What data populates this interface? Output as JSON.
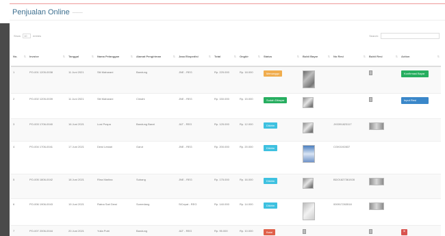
{
  "header": {
    "title": "Penjualan Online",
    "subtitle": "———"
  },
  "controls": {
    "show_label": "Show",
    "entries_value": "10",
    "entries_label": "entries",
    "search_label": "Search:"
  },
  "table": {
    "columns": [
      "No.",
      "Invoice",
      "Tanggal",
      "Nama Pelanggan",
      "Alamat Pengiriman",
      "Jasa Ekspedisi",
      "Total",
      "Ongkir",
      "Status",
      "Bukti Bayar",
      "No Resi",
      "Bukti Resi",
      "Action"
    ],
    "rows": [
      {
        "no": "1",
        "invoice": "PO-001 1205-0038",
        "date": "11 Juni 2021",
        "name": "Siti Maharani",
        "address": "Bandung",
        "courier": "JNE - REG",
        "total": "Rp. 225.000",
        "ongkir": "Rp. 18.000",
        "status": "Menunggu",
        "status_color": "warning",
        "bukti": "tall",
        "resi": "",
        "bukti_resi": "icon",
        "action": "Konfirmasi Bayar",
        "action_color": "green"
      },
      {
        "no": "2",
        "invoice": "PO-002 1205-0039",
        "date": "11 Juni 2021",
        "name": "Siti Maharani",
        "address": "Cimahi",
        "courier": "JNE - REG",
        "total": "Rp. 150.000",
        "ongkir": "Rp. 15.000",
        "status": "Sudah Dibayar",
        "status_color": "success",
        "bukti": "sq",
        "resi": "",
        "bukti_resi": "icon",
        "action": "Input Resi",
        "action_color": "blue"
      },
      {
        "no": "3",
        "invoice": "PO-003 1706-0040",
        "date": "16 Juni 2021",
        "name": "Lusi Puspa",
        "address": "Bandung Barat",
        "courier": "J&T - REG",
        "total": "Rp. 125.000",
        "ongkir": "Rp. 12.000",
        "status": "Dikirim",
        "status_color": "info",
        "bukti": "sq",
        "resi": "JX0391823117",
        "bukti_resi": "wide",
        "action": "",
        "action_color": ""
      },
      {
        "no": "4",
        "invoice": "PO-004 1706-0041",
        "date": "17 Juni 2021",
        "name": "Dewi Lestari",
        "address": "Garut",
        "courier": "JNE - REG",
        "total": "Rp. 200.000",
        "ongkir": "Rp. 20.000",
        "status": "Dikirim",
        "status_color": "info",
        "bukti": "blue",
        "resi": "CGK0192837",
        "bukti_resi": "",
        "action": "",
        "action_color": ""
      },
      {
        "no": "5",
        "invoice": "PO-005 1806-0042",
        "date": "18 Juni 2021",
        "name": "Rina Marlina",
        "address": "Subang",
        "courier": "JNE - REG",
        "total": "Rp. 175.000",
        "ongkir": "Rp. 16.000",
        "status": "Dikirim",
        "status_color": "info",
        "bukti": "sq",
        "resi": "BDO1827361928",
        "bukti_resi": "wide",
        "action": "",
        "action_color": ""
      },
      {
        "no": "6",
        "invoice": "PO-006 1906-0043",
        "date": "19 Juni 2021",
        "name": "Ratna Sari Dewi",
        "address": "Sumedang",
        "courier": "SiCepat - REG",
        "total": "Rp. 140.000",
        "ongkir": "Rp. 14.000",
        "status": "Dikirim",
        "status_color": "info",
        "bukti": "paper",
        "resi": "000917263518",
        "bukti_resi": "wide",
        "action": "",
        "action_color": ""
      },
      {
        "no": "7",
        "invoice": "PO-007 2006-0044",
        "date": "20 Juni 2021",
        "name": "Yulia Putri",
        "address": "Bandung",
        "courier": "J&T - REG",
        "total": "Rp. 95.000",
        "ongkir": "Rp. 10.000",
        "status": "Batal",
        "status_color": "danger",
        "bukti": "icon",
        "resi": "",
        "bukti_resi": "icon",
        "action": "×",
        "action_color": "red"
      }
    ]
  }
}
